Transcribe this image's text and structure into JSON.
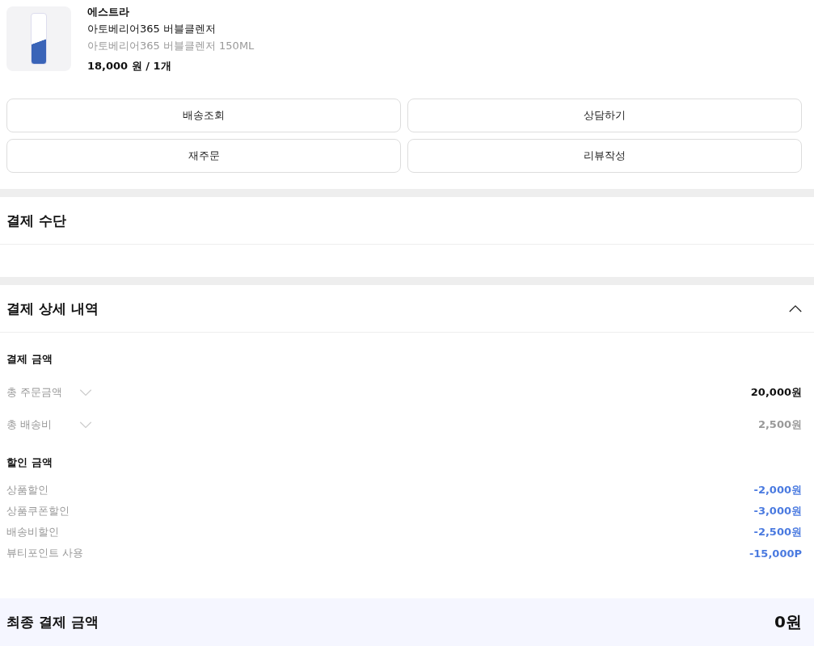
{
  "product": {
    "brand": "에스트라",
    "name": "아토베리어365 버블클렌저",
    "option": "아토베리어365 버블클렌저 150ML",
    "price": "18,000 원 / 1개"
  },
  "actions": [
    "배송조회",
    "상담하기",
    "재주문",
    "리뷰작성"
  ],
  "payment_method": {
    "title": "결제 수단"
  },
  "payment_detail": {
    "title": "결제 상세 내역",
    "expanded": true,
    "groups": [
      {
        "title": "결제 금액",
        "rows": [
          {
            "label": "총 주문금액",
            "value": "20,000원",
            "kind": "total",
            "expanded": false
          },
          {
            "label": "총 배송비",
            "value": "2,500원",
            "kind": "fee",
            "expanded": false
          }
        ]
      },
      {
        "title": "할인 금액",
        "rows": [
          {
            "label": "상품할인",
            "value": "-2,000원",
            "kind": "discount"
          },
          {
            "label": "상품쿠폰할인",
            "value": "-3,000원",
            "kind": "discount"
          },
          {
            "label": "배송비할인",
            "value": "-2,500원",
            "kind": "discount"
          },
          {
            "label": "뷰티포인트 사용",
            "value": "-15,000P",
            "kind": "discount"
          }
        ]
      }
    ]
  },
  "final": {
    "label": "최종 결제 금액",
    "value": "0원"
  }
}
